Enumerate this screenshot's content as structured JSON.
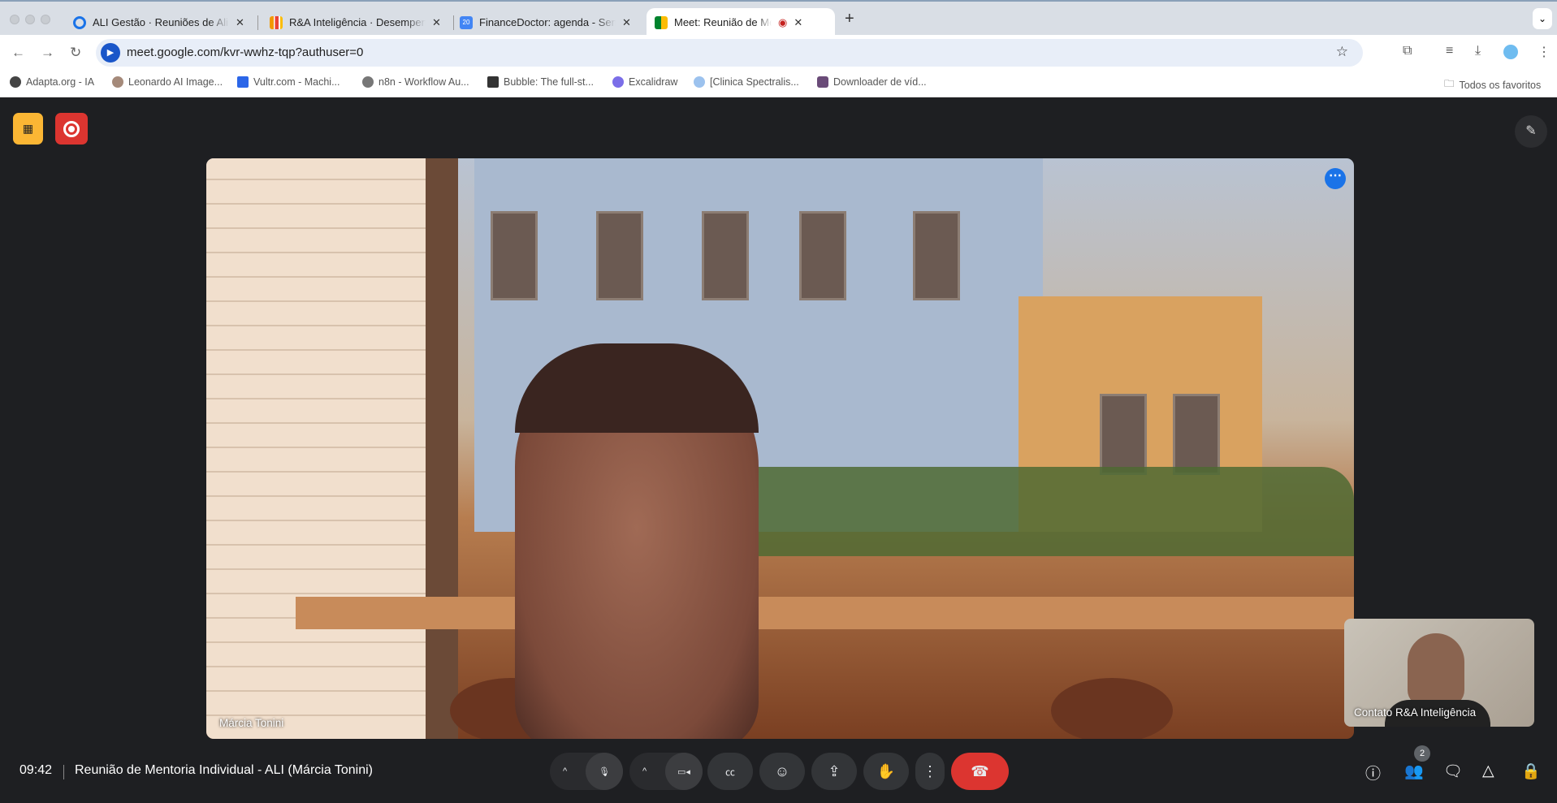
{
  "browser": {
    "tabs": [
      {
        "title": "ALI Gestão · Reuniões de Alinhamento",
        "active": false,
        "favicon": "target-icon",
        "color": "#1a73e8"
      },
      {
        "title": "R&A Inteligência · Desempenho",
        "active": false,
        "favicon": "bar-chart-icon",
        "color": "#f29900"
      },
      {
        "title": "FinanceDoctor: agenda - Semana",
        "active": false,
        "favicon": "calendar-icon",
        "color": "#4285f4"
      },
      {
        "title": "Meet: Reunião de Mentoria",
        "active": true,
        "favicon": "meet-icon",
        "color": "#00832d"
      }
    ],
    "url": "meet.google.com/kvr-wwhz-tqp?authuser=0",
    "bookmarks": [
      "Adapta.org - IA",
      "Leonardo AI Image...",
      "Vultr.com - Machi...",
      "n8n - Workflow Au...",
      "Bubble: The full-st...",
      "Excalidraw",
      "[Clinica Spectralis...",
      "Downloader de víd..."
    ],
    "all_bookmarks": "Todos os favoritos"
  },
  "meet": {
    "main_participant": "Márcia Tonini",
    "self_participant": "Contato R&A Inteligência",
    "time": "09:42",
    "meeting_title": "Reunião de Mentoria Individual - ALI (Márcia Tonini)",
    "participants_count": "2",
    "colors": {
      "recording": "#dc3530",
      "warning": "#fbb634",
      "end_call": "#dc3530",
      "accent": "#1a73e8"
    }
  }
}
